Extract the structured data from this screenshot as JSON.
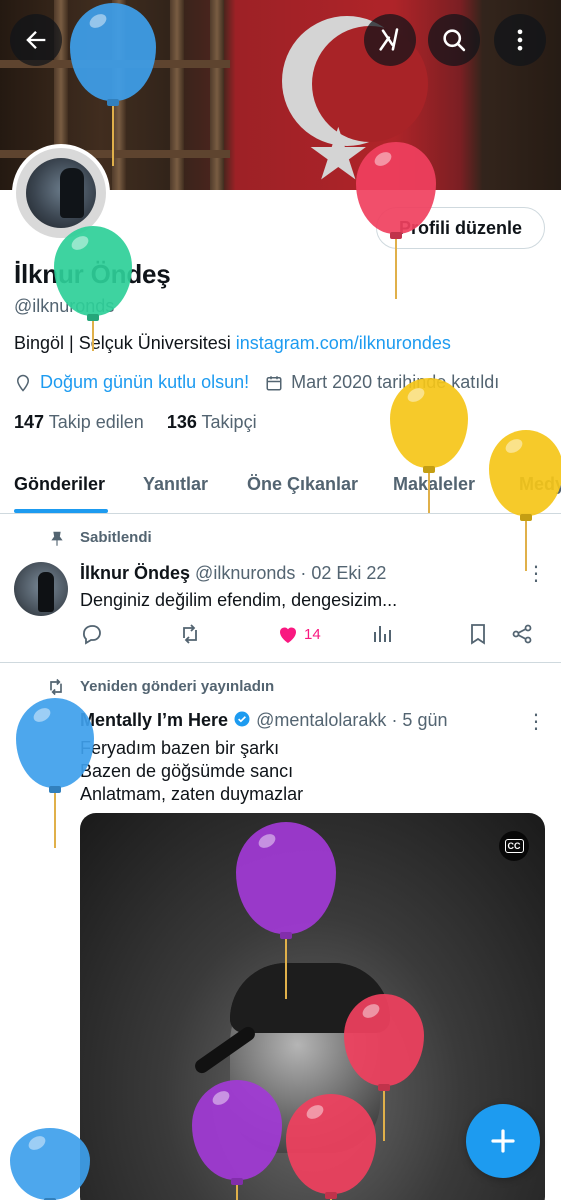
{
  "header": {
    "back_label": "Geri",
    "grok_label": "Grok",
    "search_label": "Ara",
    "more_label": "Daha fazla"
  },
  "profile": {
    "edit_button": "Profili düzenle",
    "name": "İlknur Öndeş",
    "handle": "@ilknuronds",
    "bio_text": "Bingöl | Selçuk Üniversitesi ",
    "bio_link": "instagram.com/ilknurondes",
    "birthday_text": "Doğum günün kutlu olsun!",
    "joined_text": "Mart 2020 tarihinde katıldı",
    "following_count": "147",
    "following_label": "Takip edilen",
    "followers_count": "136",
    "followers_label": "Takipçi"
  },
  "tabs": [
    {
      "label": "Gönderiler",
      "active": true
    },
    {
      "label": "Yanıtlar",
      "active": false
    },
    {
      "label": "Öne Çıkanlar",
      "active": false
    },
    {
      "label": "Makaleler",
      "active": false
    },
    {
      "label": "Medya",
      "active": false
    }
  ],
  "posts": [
    {
      "context": "Sabitlendi",
      "author_name": "İlknur Öndeş",
      "author_handle": "@ilknuronds",
      "date": "· 02 Eki 22",
      "text": "Denginiz değilim efendim, dengesizim...",
      "likes": "14"
    },
    {
      "context": "Yeniden gönderi yayınladın",
      "author_name": "Mentally I’m Here",
      "author_handle": "@mentalolarakk",
      "date": "· 5 gün",
      "lines": [
        "Feryadım bazen bir şarkı",
        "Bazen de göğsümde sancı",
        "Anlatmam, zaten duymazlar"
      ],
      "video_caption_badge": "CC"
    }
  ],
  "colors": {
    "accent": "#1d9bf0",
    "like": "#f91880",
    "text_primary": "#0f1419",
    "text_secondary": "#536471",
    "balloon_blue": "#3ea0ec",
    "balloon_red": "#f0405e",
    "balloon_yellow": "#f5c518",
    "balloon_green": "#2ecf98",
    "balloon_purple": "#a23ad6"
  },
  "icons": [
    "back-arrow-icon",
    "grok-icon",
    "search-icon",
    "more-vertical-icon",
    "location-icon",
    "calendar-icon",
    "pin-icon",
    "retweet-icon",
    "reply-icon",
    "like-icon",
    "views-icon",
    "bookmark-icon",
    "share-icon",
    "verified-icon",
    "cc-icon",
    "compose-plus-icon",
    "balloon-icon"
  ]
}
